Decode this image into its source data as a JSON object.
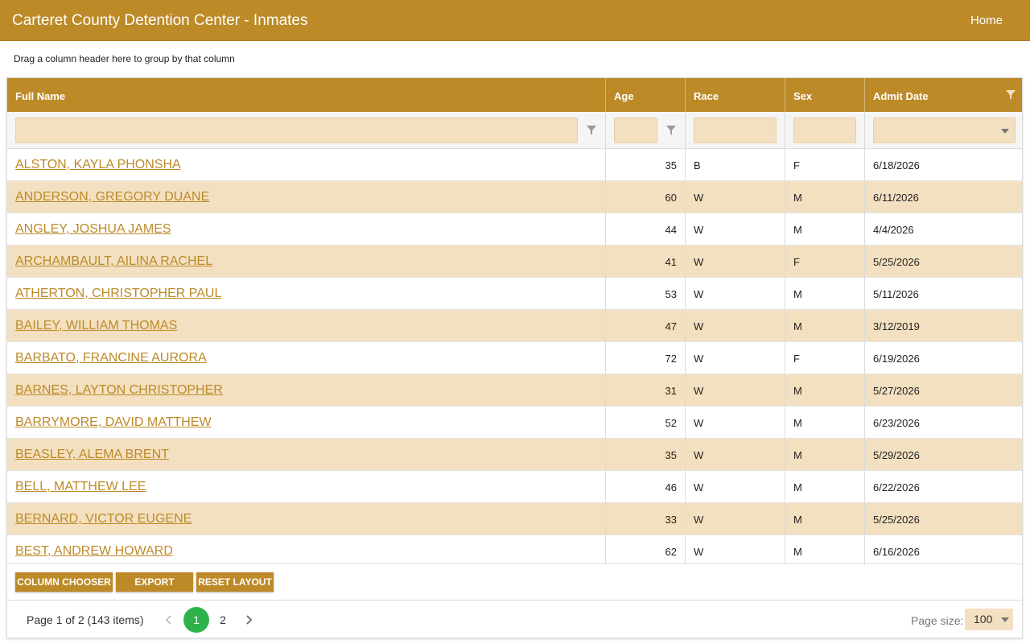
{
  "header": {
    "title": "Carteret County Detention Center - Inmates",
    "home_label": "Home"
  },
  "group_panel": {
    "hint": "Drag a column header here to group by that column"
  },
  "columns": [
    {
      "label": "Full Name"
    },
    {
      "label": "Age"
    },
    {
      "label": "Race"
    },
    {
      "label": "Sex"
    },
    {
      "label": "Admit Date"
    }
  ],
  "rows": [
    {
      "name": "ALSTON, KAYLA PHONSHA",
      "age": "35",
      "race": "B",
      "sex": "F",
      "admit": "6/18/2026"
    },
    {
      "name": "ANDERSON, GREGORY DUANE",
      "age": "60",
      "race": "W",
      "sex": "M",
      "admit": "6/11/2026"
    },
    {
      "name": "ANGLEY, JOSHUA JAMES",
      "age": "44",
      "race": "W",
      "sex": "M",
      "admit": "4/4/2026"
    },
    {
      "name": "ARCHAMBAULT, AILINA RACHEL",
      "age": "41",
      "race": "W",
      "sex": "F",
      "admit": "5/25/2026"
    },
    {
      "name": "ATHERTON, CHRISTOPHER PAUL",
      "age": "53",
      "race": "W",
      "sex": "M",
      "admit": "5/11/2026"
    },
    {
      "name": "BAILEY, WILLIAM THOMAS",
      "age": "47",
      "race": "W",
      "sex": "M",
      "admit": "3/12/2019"
    },
    {
      "name": "BARBATO, FRANCINE AURORA",
      "age": "72",
      "race": "W",
      "sex": "F",
      "admit": "6/19/2026"
    },
    {
      "name": "BARNES, LAYTON CHRISTOPHER",
      "age": "31",
      "race": "W",
      "sex": "M",
      "admit": "5/27/2026"
    },
    {
      "name": "BARRYMORE, DAVID MATTHEW",
      "age": "52",
      "race": "W",
      "sex": "M",
      "admit": "6/23/2026"
    },
    {
      "name": "BEASLEY, ALEMA BRENT",
      "age": "35",
      "race": "W",
      "sex": "M",
      "admit": "5/29/2026"
    },
    {
      "name": "BELL, MATTHEW LEE",
      "age": "46",
      "race": "W",
      "sex": "M",
      "admit": "6/22/2026"
    },
    {
      "name": "BERNARD, VICTOR EUGENE",
      "age": "33",
      "race": "W",
      "sex": "M",
      "admit": "5/25/2026"
    },
    {
      "name": "BEST, ANDREW HOWARD",
      "age": "62",
      "race": "W",
      "sex": "M",
      "admit": "6/16/2026"
    }
  ],
  "toolbar": {
    "column_chooser": "COLUMN CHOOSER",
    "export": "EXPORT",
    "reset_layout": "RESET LAYOUT"
  },
  "pager": {
    "info": "Page 1 of 2 (143 items)",
    "pages": [
      "1",
      "2"
    ],
    "page_size_label": "Page size:",
    "page_size": "100"
  },
  "icons": {
    "filter": "filter-icon",
    "prev": "chevron-left-icon",
    "next": "chevron-right-icon",
    "dropdown": "caret-down-icon"
  },
  "colors": {
    "brand": "#bd8a28",
    "row_alt": "#f3e0c0",
    "active_page": "#2db34a"
  }
}
